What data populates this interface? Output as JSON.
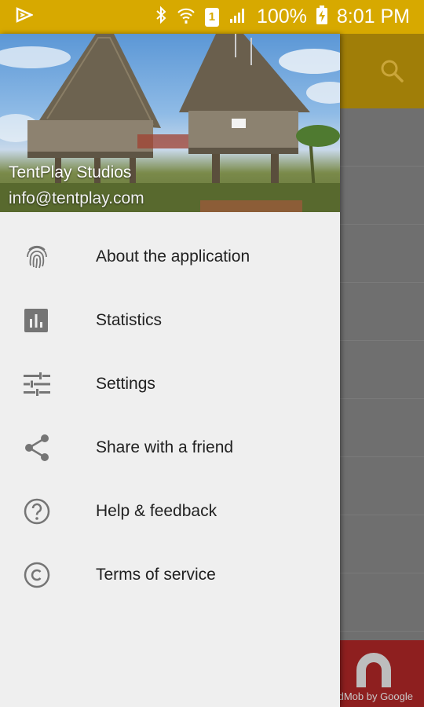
{
  "status_bar": {
    "battery_percent": "100%",
    "time": "8:01 PM",
    "sim_badge": "1",
    "icons": [
      "notification-icon",
      "bluetooth-icon",
      "wifi-icon",
      "signal-icon",
      "battery-charging-icon"
    ]
  },
  "drawer": {
    "header": {
      "name": "TentPlay Studios",
      "email": "info@tentplay.com"
    },
    "items": [
      {
        "label": "About the application",
        "icon": "fingerprint-icon"
      },
      {
        "label": "Statistics",
        "icon": "chart-icon"
      },
      {
        "label": "Settings",
        "icon": "tune-icon"
      },
      {
        "label": "Share with a friend",
        "icon": "share-icon"
      },
      {
        "label": "Help & feedback",
        "icon": "help-icon"
      },
      {
        "label": "Terms of service",
        "icon": "copyright-icon"
      }
    ]
  },
  "background": {
    "ad_text": "AdMob by Google"
  },
  "colors": {
    "status_bar": "#d7a900",
    "toolbar_dimmed": "#a07e08",
    "drawer_bg": "#efefef",
    "icon_gray": "#757575"
  }
}
